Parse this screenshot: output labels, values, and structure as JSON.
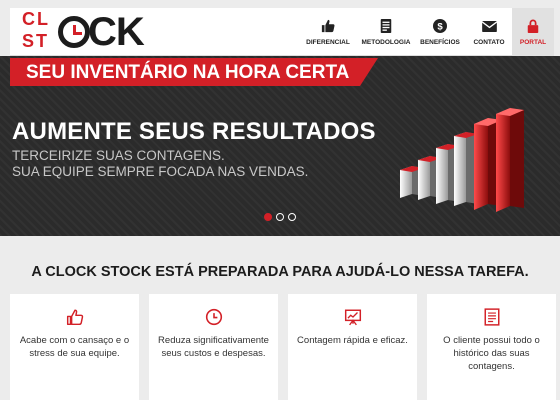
{
  "logo": {
    "line1": "CL",
    "line2": "ST",
    "suffix": "CK"
  },
  "nav": {
    "items": [
      {
        "label": "DIFERENCIAL",
        "icon": "thumbs-up-icon"
      },
      {
        "label": "METODOLOGIA",
        "icon": "document-icon"
      },
      {
        "label": "BENEFÍCIOS",
        "icon": "dollar-icon"
      },
      {
        "label": "CONTATO",
        "icon": "envelope-icon"
      },
      {
        "label": "PORTAL",
        "icon": "lock-icon"
      }
    ]
  },
  "hero": {
    "banner": "SEU INVENTÁRIO NA HORA CERTA",
    "title": "AUMENTE SEUS RESULTADOS",
    "subtitle_line1": "TERCEIRIZE SUAS CONTAGENS.",
    "subtitle_line2": "SUA EQUIPE SEMPRE FOCADA NAS VENDAS.",
    "slide_count": 3,
    "active_slide": 1
  },
  "section": {
    "title": "A CLOCK STOCK ESTÁ PREPARADA PARA AJUDÁ-LO NESSA TAREFA."
  },
  "cards": [
    {
      "icon": "thumbs-up-icon",
      "text": "Acabe com o cansaço e o stress de sua equipe."
    },
    {
      "icon": "clock-icon",
      "text": "Reduza significativamente seus custos e despesas."
    },
    {
      "icon": "presentation-chart-icon",
      "text": "Contagem rápida e eficaz."
    },
    {
      "icon": "document-icon",
      "text": "O cliente possui todo o histórico das suas contagens."
    }
  ],
  "colors": {
    "brand_red": "#d32027",
    "dark": "#2b2b2b",
    "light_bg": "#ececec"
  }
}
